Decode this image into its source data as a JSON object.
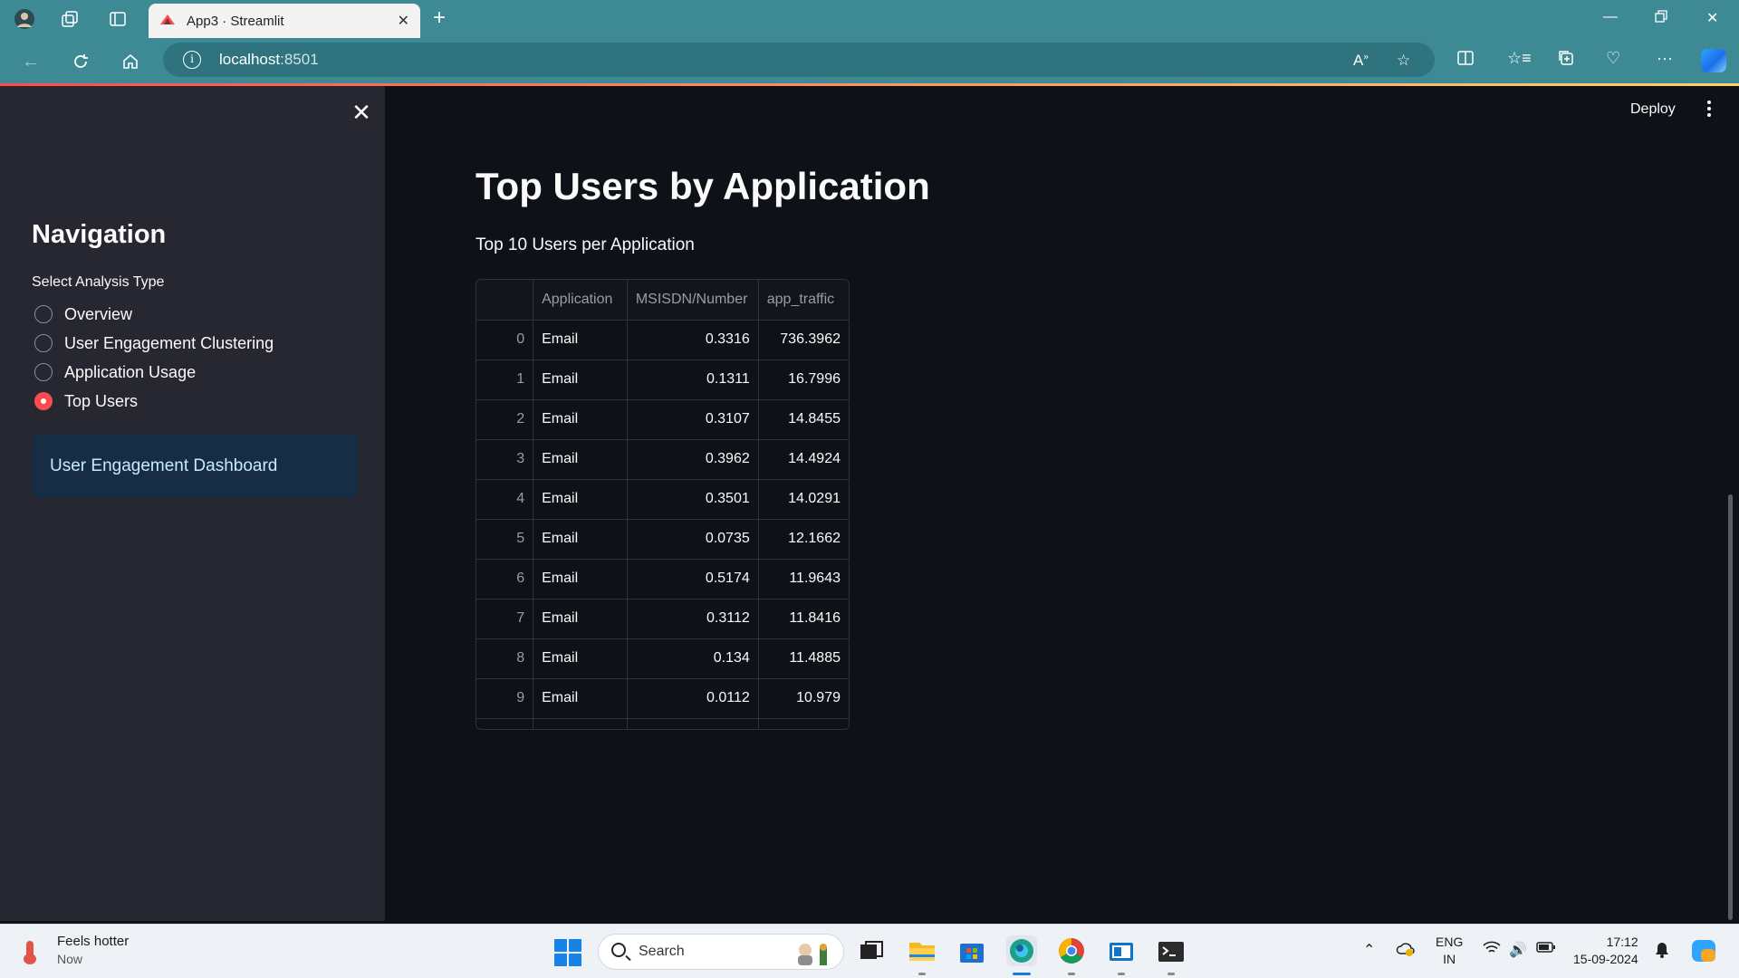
{
  "browser": {
    "tab_title": "App3 · Streamlit",
    "url_host": "localhost",
    "url_port": ":8501"
  },
  "app": {
    "deploy_label": "Deploy",
    "page_title": "Top Users by Application",
    "subtitle": "Top 10 Users per Application"
  },
  "sidebar": {
    "title": "Navigation",
    "radio_label": "Select Analysis Type",
    "options": [
      "Overview",
      "User Engagement Clustering",
      "Application Usage",
      "Top Users"
    ],
    "selected": "Top Users",
    "info_box": "User Engagement Dashboard"
  },
  "table": {
    "columns": [
      "",
      "Application",
      "MSISDN/Number",
      "app_traffic"
    ],
    "rows": [
      [
        "0",
        "Email",
        "0.3316",
        "736.3962"
      ],
      [
        "1",
        "Email",
        "0.1311",
        "16.7996"
      ],
      [
        "2",
        "Email",
        "0.3107",
        "14.8455"
      ],
      [
        "3",
        "Email",
        "0.3962",
        "14.4924"
      ],
      [
        "4",
        "Email",
        "0.3501",
        "14.0291"
      ],
      [
        "5",
        "Email",
        "0.0735",
        "12.1662"
      ],
      [
        "6",
        "Email",
        "0.5174",
        "11.9643"
      ],
      [
        "7",
        "Email",
        "0.3112",
        "11.8416"
      ],
      [
        "8",
        "Email",
        "0.134",
        "11.4885"
      ],
      [
        "9",
        "Email",
        "0.0112",
        "10.979"
      ]
    ]
  },
  "taskbar": {
    "weather_title": "Feels hotter",
    "weather_sub": "Now",
    "search_placeholder": "Search",
    "lang_line1": "ENG",
    "lang_line2": "IN",
    "time": "17:12",
    "date": "15-09-2024"
  },
  "colors": {
    "accent": "#ff4b4b",
    "browser_chrome": "#3d8a95",
    "sidebar_bg": "#262730",
    "main_bg": "#0e1117",
    "info_bg": "#172d43"
  }
}
